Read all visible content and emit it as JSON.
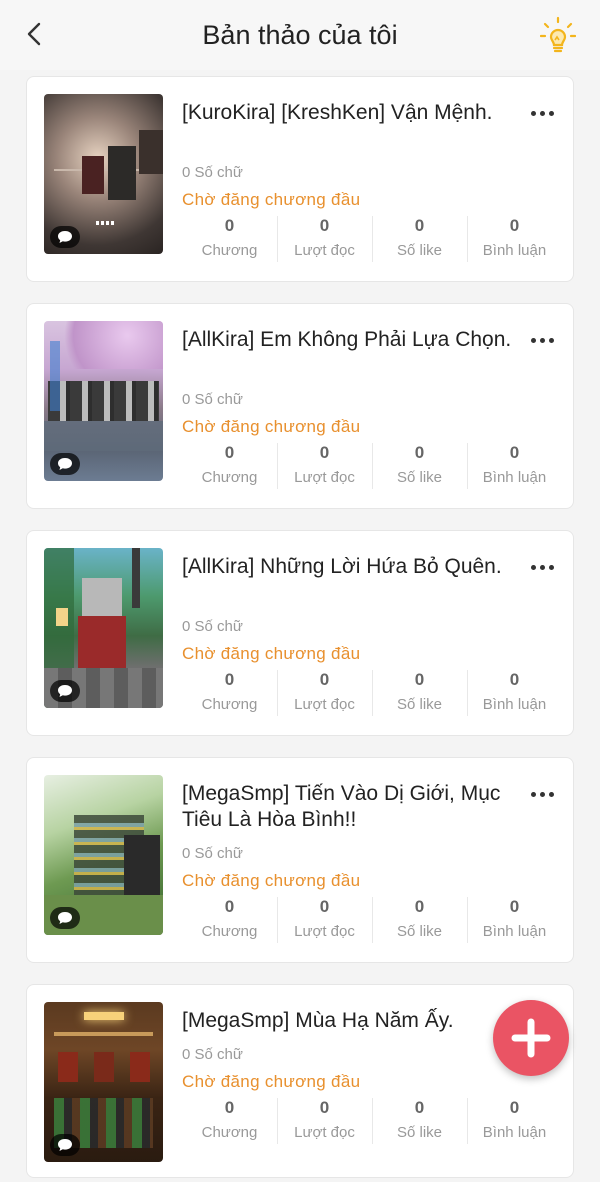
{
  "header": {
    "title": "Bản thảo của tôi"
  },
  "colors": {
    "status": "#e8902e",
    "fab": "#ea5464",
    "bulb": "#f3b51c"
  },
  "icons": {
    "back": "chevron-left-icon",
    "ideas": "lightbulb-icon",
    "more": "more-horizontal-icon",
    "comment": "chat-bubble-icon",
    "add": "plus-icon"
  },
  "drafts": [
    {
      "title": "[KuroKira] [KreshKen] Vận Mệnh.",
      "word_count": "0 Số chữ",
      "status": "Chờ đăng chương đầu",
      "stats": [
        {
          "value": "0",
          "label": "Chương"
        },
        {
          "value": "0",
          "label": "Lượt đọc"
        },
        {
          "value": "0",
          "label": "Số like"
        },
        {
          "value": "0",
          "label": "Bình luận"
        }
      ]
    },
    {
      "title": "[AllKira] Em Không Phải Lựa Chọn.",
      "word_count": "0 Số chữ",
      "status": "Chờ đăng chương đầu",
      "stats": [
        {
          "value": "0",
          "label": "Chương"
        },
        {
          "value": "0",
          "label": "Lượt đọc"
        },
        {
          "value": "0",
          "label": "Số like"
        },
        {
          "value": "0",
          "label": "Bình luận"
        }
      ]
    },
    {
      "title": "[AllKira] Những Lời Hứa Bỏ Quên.",
      "word_count": "0 Số chữ",
      "status": "Chờ đăng chương đầu",
      "stats": [
        {
          "value": "0",
          "label": "Chương"
        },
        {
          "value": "0",
          "label": "Lượt đọc"
        },
        {
          "value": "0",
          "label": "Số like"
        },
        {
          "value": "0",
          "label": "Bình luận"
        }
      ]
    },
    {
      "title": "[MegaSmp] Tiến Vào Dị Giới, Mục Tiêu Là Hòa Bình!!",
      "word_count": "0 Số chữ",
      "status": "Chờ đăng chương đầu",
      "stats": [
        {
          "value": "0",
          "label": "Chương"
        },
        {
          "value": "0",
          "label": "Lượt đọc"
        },
        {
          "value": "0",
          "label": "Số like"
        },
        {
          "value": "0",
          "label": "Bình luận"
        }
      ]
    },
    {
      "title": "[MegaSmp] Mùa Hạ Năm Ấy.",
      "word_count": "0 Số chữ",
      "status": "Chờ đăng chương đầu",
      "stats": [
        {
          "value": "0",
          "label": "Chương"
        },
        {
          "value": "0",
          "label": "Lượt đọc"
        },
        {
          "value": "0",
          "label": "Số like"
        },
        {
          "value": "0",
          "label": "Bình luận"
        }
      ]
    }
  ]
}
